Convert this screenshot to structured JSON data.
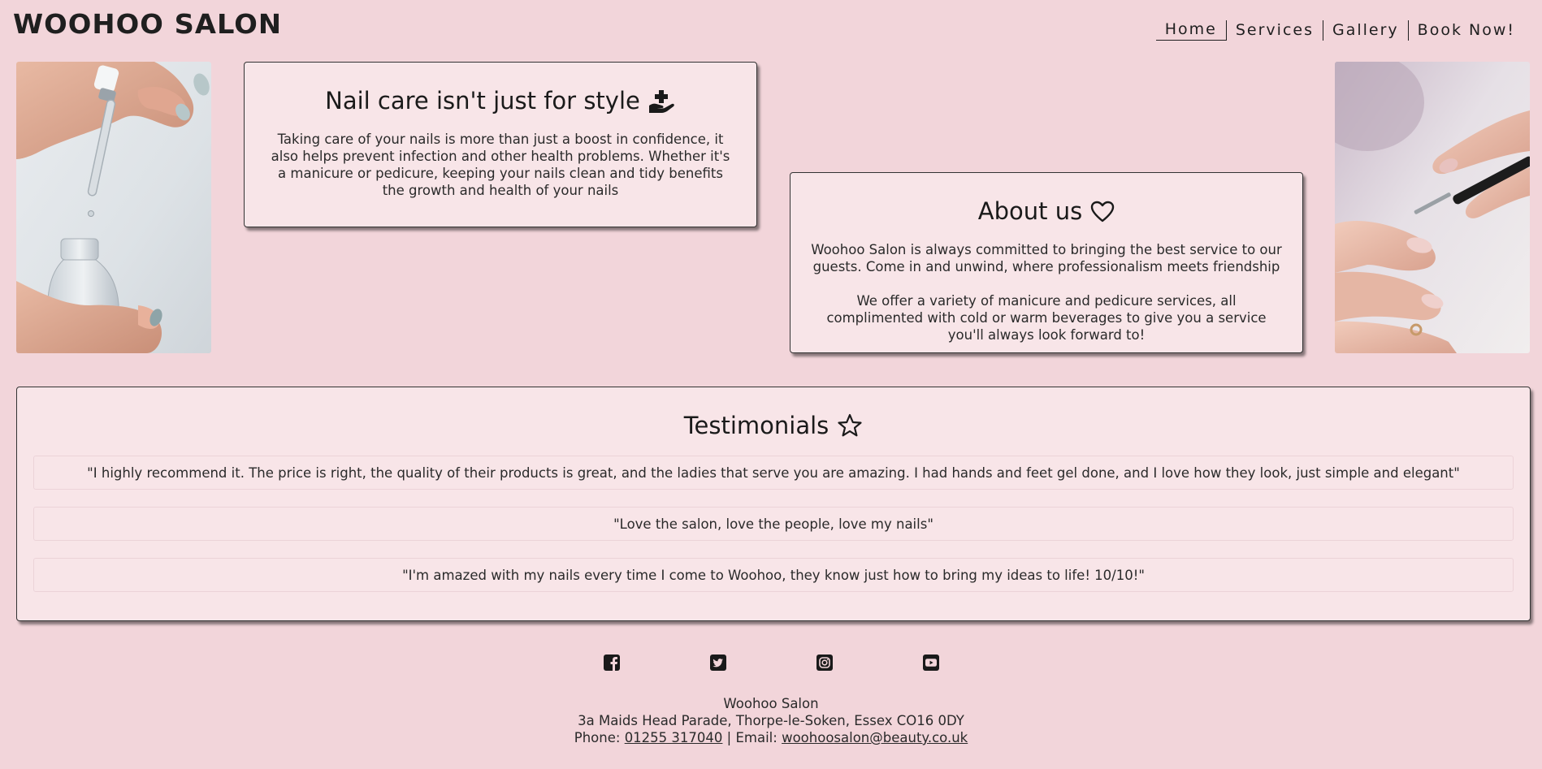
{
  "header": {
    "logo": "WOOHOO SALON",
    "nav": [
      {
        "label": "Home",
        "active": true
      },
      {
        "label": "Services"
      },
      {
        "label": "Gallery"
      },
      {
        "label": "Book Now!"
      }
    ]
  },
  "nail_care": {
    "title": "Nail care isn't just for style",
    "icon": "hand-holding-medical-icon",
    "text": "Taking care of your nails is more than just a boost in confidence, it also helps prevent infection and other health problems. Whether it's a manicure or pedicure, keeping your nails clean and tidy benefits the growth and health of your nails"
  },
  "about": {
    "title": "About us",
    "icon": "heart-icon",
    "paragraphs": [
      "Woohoo Salon is always committed to bringing the best service to our guests. Come in and unwind, where professionalism meets friendship",
      "We offer a variety of manicure and pedicure services, all complimented with cold or warm beverages to give you a service you'll always look forward to!"
    ]
  },
  "testimonials": {
    "title": "Testimonials",
    "icon": "star-icon",
    "quotes": [
      "\"I highly recommend it. The price is right, the quality of their products is great, and the ladies that serve you are amazing. I had hands and feet gel done, and I love how they look, just simple and elegant\"",
      "\"Love the salon, love the people, love my nails\"",
      "\"I'm amazed with my nails every time I come to Woohoo, they know just how to bring my ideas to life! 10/10!\""
    ]
  },
  "social": [
    "facebook-icon",
    "twitter-icon",
    "instagram-icon",
    "youtube-icon"
  ],
  "footer": {
    "name": "Woohoo Salon",
    "address": "3a Maids Head Parade, Thorpe-le-Soken, Essex CO16 0DY",
    "phone_label": "Phone:",
    "phone": "01255 317040",
    "separator": "|",
    "email_label": "Email:",
    "email": "woohoosalon@beauty.co.uk"
  },
  "colors": {
    "background": "#f2d5da",
    "card": "#f8e5e8",
    "text": "#1e1e1e"
  }
}
